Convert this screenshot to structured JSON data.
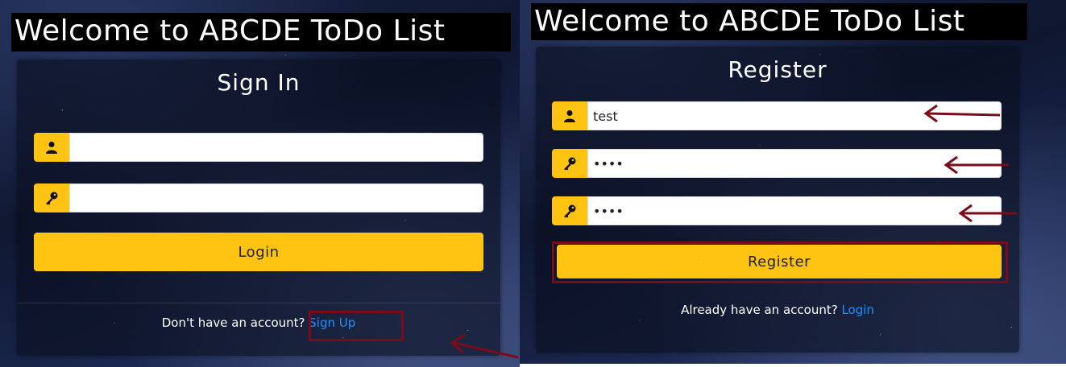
{
  "colors": {
    "accent": "#ffc312",
    "link": "#1e90ff",
    "annotation": "#7a0b1a"
  },
  "signin": {
    "title": "Welcome to ABCDE ToDo List",
    "heading": "Sign In",
    "username_icon": "user-icon",
    "username_value": "",
    "password_icon": "key-icon",
    "password_value": "",
    "login_label": "Login",
    "footer_prefix": "Don't have an account?",
    "signup_link": "Sign Up"
  },
  "register": {
    "title": "Welcome to ABCDE ToDo List",
    "heading": "Register",
    "username_icon": "user-icon",
    "username_value": "test",
    "password_icon": "key-icon",
    "password_value": "••••",
    "confirm_icon": "key-icon",
    "confirm_value": "••••",
    "register_label": "Register",
    "footer_prefix": "Already have an account?",
    "login_link": "Login"
  }
}
